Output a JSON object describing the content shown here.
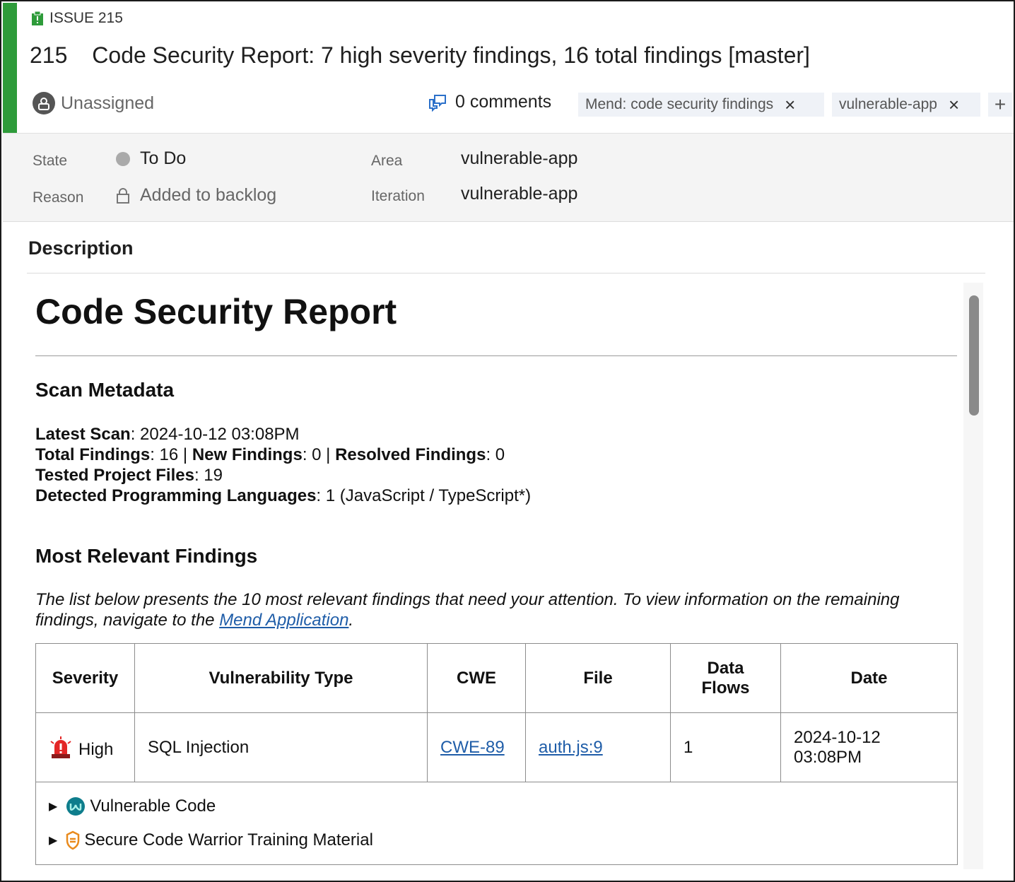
{
  "issue": {
    "type_label": "ISSUE 215",
    "id": "215",
    "title": "Code Security Report: 7 high severity findings, 16 total findings [master]",
    "assignee": "Unassigned",
    "comments": "0 comments",
    "tags": [
      "Mend: code security findings",
      "vulnerable-app"
    ],
    "add_tag": "+",
    "remove_tag": "×",
    "accent_color": "#2e9b3a"
  },
  "fields": {
    "state_label": "State",
    "state_value": "To Do",
    "reason_label": "Reason",
    "reason_value": "Added to backlog",
    "area_label": "Area",
    "area_value": "vulnerable-app",
    "iteration_label": "Iteration",
    "iteration_value": "vulnerable-app"
  },
  "description": {
    "heading": "Description",
    "report_title": "Code Security Report",
    "scan_metadata_heading": "Scan Metadata",
    "latest_scan_label": "Latest Scan",
    "latest_scan_value": ": 2024-10-12 03:08PM",
    "total_findings_label": "Total Findings",
    "total_findings_value": ": 16 | ",
    "new_findings_label": "New Findings",
    "new_findings_value": ": 0 | ",
    "resolved_findings_label": "Resolved Findings",
    "resolved_findings_value": ": 0",
    "tested_files_label": "Tested Project Files",
    "tested_files_value": ": 19",
    "languages_label": "Detected Programming Languages",
    "languages_value": ": 1 (JavaScript / TypeScript*)",
    "findings_heading": "Most Relevant Findings",
    "intro_text": "The list below presents the 10 most relevant findings that need your attention. To view information on the remaining findings, navigate to the ",
    "intro_link": "Mend Application",
    "intro_end": ".",
    "table": {
      "headers": [
        "Severity",
        "Vulnerability Type",
        "CWE",
        "File",
        "Data Flows",
        "Date"
      ],
      "rows": [
        {
          "severity": "High",
          "type": "SQL Injection",
          "cwe": "CWE-89",
          "file": "auth.js:9",
          "data_flows": "1",
          "date": "2024-10-12 03:08PM"
        }
      ],
      "details": [
        "Vulnerable Code",
        "Secure Code Warrior Training Material"
      ]
    }
  }
}
